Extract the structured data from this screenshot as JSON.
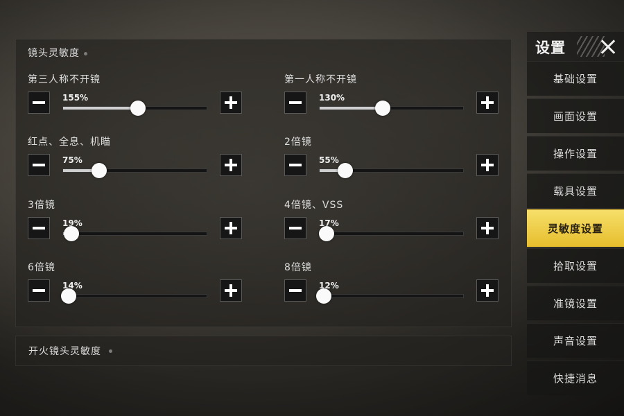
{
  "header": {
    "title": "设置"
  },
  "section": {
    "title": "镜头灵敏度"
  },
  "sliders": [
    {
      "label": "第三人称不开镜",
      "value_text": "155%",
      "fraction": 0.52
    },
    {
      "label": "第一人称不开镜",
      "value_text": "130%",
      "fraction": 0.44
    },
    {
      "label": "红点、全息、机瞄",
      "value_text": "75%",
      "fraction": 0.25
    },
    {
      "label": "2倍镜",
      "value_text": "55%",
      "fraction": 0.18
    },
    {
      "label": "3倍镜",
      "value_text": "19%",
      "fraction": 0.06
    },
    {
      "label": "4倍镜、VSS",
      "value_text": "17%",
      "fraction": 0.05
    },
    {
      "label": "6倍镜",
      "value_text": "14%",
      "fraction": 0.04
    },
    {
      "label": "8倍镜",
      "value_text": "12%",
      "fraction": 0.03
    }
  ],
  "fire_section": {
    "title": "开火镜头灵敏度"
  },
  "menu": {
    "items": [
      {
        "label": "基础设置"
      },
      {
        "label": "画面设置"
      },
      {
        "label": "操作设置"
      },
      {
        "label": "载具设置"
      },
      {
        "label": "灵敏度设置"
      },
      {
        "label": "拾取设置"
      },
      {
        "label": "准镜设置"
      },
      {
        "label": "声音设置"
      },
      {
        "label": "快捷消息"
      }
    ],
    "active_index": 4
  },
  "colors": {
    "active_tab": "#f0cd45",
    "panel": "#23221f"
  }
}
